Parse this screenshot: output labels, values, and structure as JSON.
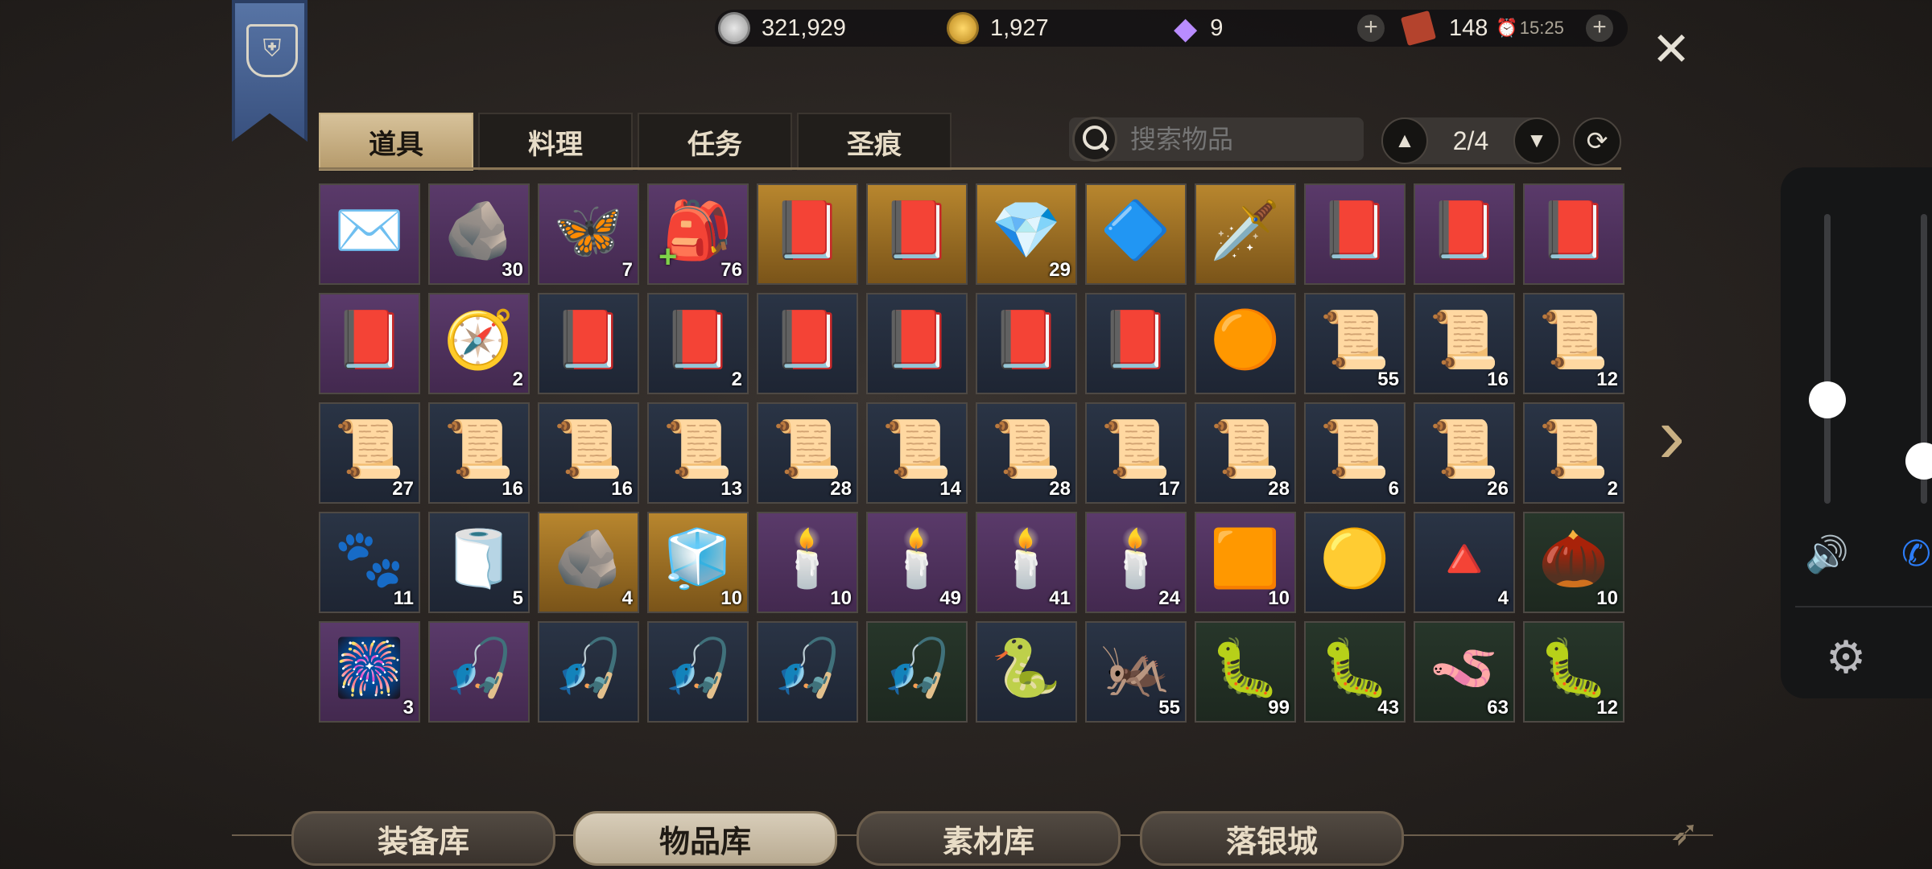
{
  "resources": {
    "silver": "321,929",
    "gold": "1,927",
    "gems": "9",
    "stamina": "148",
    "timer": "15:25"
  },
  "colors": {
    "tab_active": "#cdb78a",
    "rarity_blue": "#263041",
    "rarity_purple": "#4f3360",
    "rarity_gold": "#a07426",
    "rarity_green": "#22302a"
  },
  "tabs": [
    "道具",
    "料理",
    "任务",
    "圣痕"
  ],
  "search": {
    "placeholder": "搜索物品"
  },
  "pager": {
    "page": "2/4"
  },
  "items": [
    {
      "icon": "✉️",
      "rarity": "purple",
      "count": ""
    },
    {
      "icon": "🪨",
      "rarity": "purple",
      "count": "30"
    },
    {
      "icon": "🦋",
      "rarity": "purple",
      "count": "7"
    },
    {
      "icon": "🎒",
      "rarity": "purple",
      "count": "76",
      "badge": "+"
    },
    {
      "icon": "📕",
      "rarity": "gold",
      "count": ""
    },
    {
      "icon": "📕",
      "rarity": "gold",
      "count": ""
    },
    {
      "icon": "💎",
      "rarity": "gold",
      "count": "29"
    },
    {
      "icon": "🔷",
      "rarity": "gold",
      "count": ""
    },
    {
      "icon": "🗡️",
      "rarity": "gold",
      "count": ""
    },
    {
      "icon": "📕",
      "rarity": "purple",
      "count": ""
    },
    {
      "icon": "📕",
      "rarity": "purple",
      "count": ""
    },
    {
      "icon": "📕",
      "rarity": "purple",
      "count": ""
    },
    {
      "icon": "📕",
      "rarity": "purple",
      "count": ""
    },
    {
      "icon": "🧭",
      "rarity": "purple",
      "count": "2"
    },
    {
      "icon": "📕",
      "rarity": "blue",
      "count": ""
    },
    {
      "icon": "📕",
      "rarity": "blue",
      "count": "2"
    },
    {
      "icon": "📕",
      "rarity": "blue",
      "count": ""
    },
    {
      "icon": "📕",
      "rarity": "blue",
      "count": ""
    },
    {
      "icon": "📕",
      "rarity": "blue",
      "count": ""
    },
    {
      "icon": "📕",
      "rarity": "blue",
      "count": ""
    },
    {
      "icon": "🟠",
      "rarity": "blue",
      "count": ""
    },
    {
      "icon": "📜",
      "rarity": "blue",
      "count": "55"
    },
    {
      "icon": "📜",
      "rarity": "blue",
      "count": "16"
    },
    {
      "icon": "📜",
      "rarity": "blue",
      "count": "12"
    },
    {
      "icon": "📜",
      "rarity": "blue",
      "count": "27"
    },
    {
      "icon": "📜",
      "rarity": "blue",
      "count": "16"
    },
    {
      "icon": "📜",
      "rarity": "blue",
      "count": "16"
    },
    {
      "icon": "📜",
      "rarity": "blue",
      "count": "13"
    },
    {
      "icon": "📜",
      "rarity": "blue",
      "count": "28"
    },
    {
      "icon": "📜",
      "rarity": "blue",
      "count": "14"
    },
    {
      "icon": "📜",
      "rarity": "blue",
      "count": "28"
    },
    {
      "icon": "📜",
      "rarity": "blue",
      "count": "17"
    },
    {
      "icon": "📜",
      "rarity": "blue",
      "count": "28"
    },
    {
      "icon": "📜",
      "rarity": "blue",
      "count": "6"
    },
    {
      "icon": "📜",
      "rarity": "blue",
      "count": "26"
    },
    {
      "icon": "📜",
      "rarity": "blue",
      "count": "2"
    },
    {
      "icon": "🐾",
      "rarity": "blue",
      "count": "11"
    },
    {
      "icon": "🧻",
      "rarity": "blue",
      "count": "5"
    },
    {
      "icon": "🪨",
      "rarity": "gold",
      "count": "4"
    },
    {
      "icon": "🧊",
      "rarity": "gold",
      "count": "10"
    },
    {
      "icon": "🕯️",
      "rarity": "purple",
      "count": "10"
    },
    {
      "icon": "🕯️",
      "rarity": "purple",
      "count": "49"
    },
    {
      "icon": "🕯️",
      "rarity": "purple",
      "count": "41"
    },
    {
      "icon": "🕯️",
      "rarity": "purple",
      "count": "24"
    },
    {
      "icon": "🟧",
      "rarity": "purple",
      "count": "10"
    },
    {
      "icon": "🟡",
      "rarity": "blue",
      "count": ""
    },
    {
      "icon": "🔺",
      "rarity": "blue",
      "count": "4"
    },
    {
      "icon": "🌰",
      "rarity": "green",
      "count": "10"
    },
    {
      "icon": "🎆",
      "rarity": "purple",
      "count": "3"
    },
    {
      "icon": "🎣",
      "rarity": "purple",
      "count": ""
    },
    {
      "icon": "🎣",
      "rarity": "blue",
      "count": ""
    },
    {
      "icon": "🎣",
      "rarity": "blue",
      "count": ""
    },
    {
      "icon": "🎣",
      "rarity": "blue",
      "count": ""
    },
    {
      "icon": "🎣",
      "rarity": "green",
      "count": ""
    },
    {
      "icon": "🐍",
      "rarity": "blue",
      "count": ""
    },
    {
      "icon": "🦗",
      "rarity": "blue",
      "count": "55"
    },
    {
      "icon": "🐛",
      "rarity": "green",
      "count": "99"
    },
    {
      "icon": "🐛",
      "rarity": "green",
      "count": "43"
    },
    {
      "icon": "🪱",
      "rarity": "green",
      "count": "63"
    },
    {
      "icon": "🐛",
      "rarity": "green",
      "count": "12"
    }
  ],
  "bottom_tabs": [
    "装备库",
    "物品库",
    "素材库",
    "落银城"
  ]
}
